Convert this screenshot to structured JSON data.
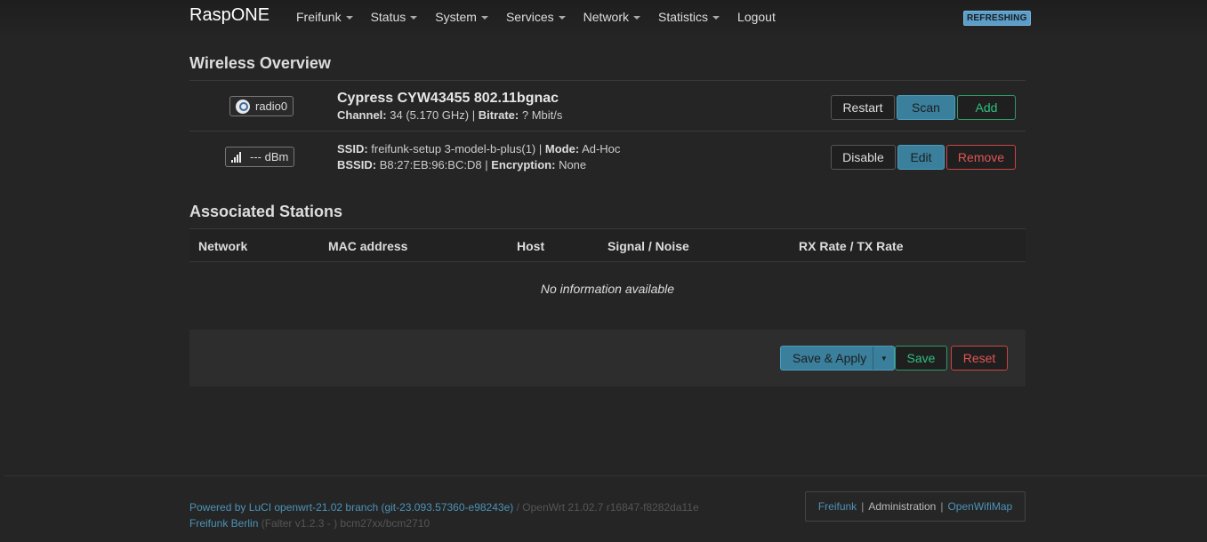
{
  "header": {
    "brand": "RaspONE",
    "menu": [
      "Freifunk",
      "Status",
      "System",
      "Services",
      "Network",
      "Statistics"
    ],
    "logout": "Logout",
    "badge": "REFRESHING"
  },
  "wireless": {
    "title": "Wireless Overview",
    "radio": {
      "badge": "radio0",
      "name": "Cypress CYW43455 802.11bgnac",
      "channel_label": "Channel:",
      "channel_value": "34 (5.170 GHz)",
      "bitrate_label": "Bitrate:",
      "bitrate_value": "? Mbit/s",
      "buttons": {
        "restart": "Restart",
        "scan": "Scan",
        "add": "Add"
      }
    },
    "network": {
      "signal": "--- dBm",
      "ssid_label": "SSID:",
      "ssid_value": "freifunk-setup 3-model-b-plus(1)",
      "mode_label": "Mode:",
      "mode_value": "Ad-Hoc",
      "bssid_label": "BSSID:",
      "bssid_value": "B8:27:EB:96:BC:D8",
      "encryption_label": "Encryption:",
      "encryption_value": "None",
      "buttons": {
        "disable": "Disable",
        "edit": "Edit",
        "remove": "Remove"
      }
    }
  },
  "stations": {
    "title": "Associated Stations",
    "columns": [
      "Network",
      "MAC address",
      "Host",
      "Signal / Noise",
      "RX Rate / TX Rate"
    ],
    "empty": "No information available"
  },
  "actions": {
    "save_apply": "Save & Apply",
    "save": "Save",
    "reset": "Reset"
  },
  "footer": {
    "powered": "Powered by LuCI openwrt-21.02 branch (git-23.093.57360-e98243e)",
    "openwrt": "/ OpenWrt 21.02.7 r16847-f8282da11e",
    "freifunk_berlin": "Freifunk Berlin",
    "falter": "(Falter v1.2.3 - ) bcm27xx/bcm2710",
    "links": {
      "freifunk": "Freifunk",
      "administration": "Administration",
      "openwifimap": "OpenWifiMap"
    }
  }
}
